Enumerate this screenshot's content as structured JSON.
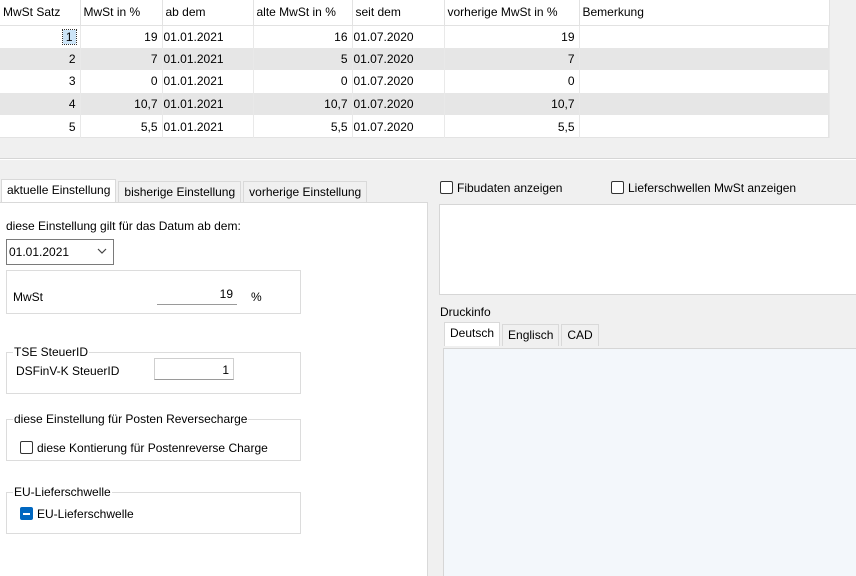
{
  "table": {
    "columns": [
      "MwSt Satz",
      "MwSt in %",
      "ab dem",
      "alte MwSt in %",
      "seit dem",
      "vorherige MwSt in %",
      "Bemerkung"
    ],
    "rows": [
      {
        "satz": "1",
        "mwst": "19",
        "ab": "01.01.2021",
        "alt": "16",
        "seit": "01.07.2020",
        "vorherige": "19",
        "bemerkung": ""
      },
      {
        "satz": "2",
        "mwst": "7",
        "ab": "01.01.2021",
        "alt": "5",
        "seit": "01.07.2020",
        "vorherige": "7",
        "bemerkung": ""
      },
      {
        "satz": "3",
        "mwst": "0",
        "ab": "01.01.2021",
        "alt": "0",
        "seit": "01.07.2020",
        "vorherige": "0",
        "bemerkung": ""
      },
      {
        "satz": "4",
        "mwst": "10,7",
        "ab": "01.01.2021",
        "alt": "10,7",
        "seit": "01.07.2020",
        "vorherige": "10,7",
        "bemerkung": ""
      },
      {
        "satz": "5",
        "mwst": "5,5",
        "ab": "01.01.2021",
        "alt": "5,5",
        "seit": "01.07.2020",
        "vorherige": "5,5",
        "bemerkung": ""
      }
    ]
  },
  "left_tabs": [
    "aktuelle Einstellung",
    "bisherige Einstellung",
    "vorherige Einstellung"
  ],
  "settings": {
    "date_label": "diese Einstellung gilt für das Datum ab dem:",
    "date_value": "01.01.2021",
    "mwst_label": "MwSt",
    "mwst_value": "19",
    "mwst_unit": "%",
    "tse_title": "TSE SteuerID",
    "dsfinv_label": "DSFinV-K SteuerID",
    "dsfinv_value": "1",
    "reverse_title": "diese Einstellung für Posten Reversecharge",
    "reverse_checkbox": "diese Kontierung für Postenreverse Charge",
    "eu_title": "EU-Lieferschwelle",
    "eu_checkbox": "EU-Lieferschwelle"
  },
  "right": {
    "fibu_checkbox": "Fibudaten anzeigen",
    "liefer_checkbox": "Lieferschwellen MwSt anzeigen",
    "druckinfo_label": "Druckinfo",
    "tabs": [
      "Deutsch",
      "Englisch",
      "CAD"
    ]
  },
  "colors": {
    "accent": "#0067c0",
    "row_alt": "#e6e6e6",
    "selection": "#cce4f7"
  }
}
